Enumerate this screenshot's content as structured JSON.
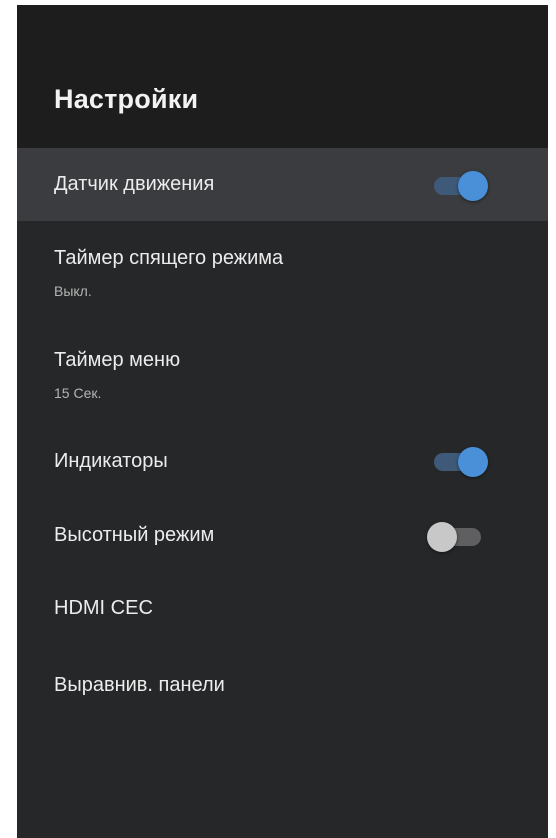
{
  "header": {
    "title": "Настройки"
  },
  "settings": {
    "motion_sensor": {
      "label": "Датчик движения",
      "toggle": "on"
    },
    "sleep_timer": {
      "label": "Таймер спящего режима",
      "value": "Выкл."
    },
    "menu_timer": {
      "label": "Таймер меню",
      "value": "15 Сек."
    },
    "indicators": {
      "label": "Индикаторы",
      "toggle": "on"
    },
    "high_altitude": {
      "label": "Высотный режим",
      "toggle": "off"
    },
    "hdmi_cec": {
      "label": "HDMI CEC"
    },
    "panel_align": {
      "label": "Выравнив. панели"
    }
  },
  "colors": {
    "accent": "#4a90d9",
    "background": "#262729",
    "header_background": "#1d1d1e",
    "focused_row": "#3b3c3f"
  }
}
